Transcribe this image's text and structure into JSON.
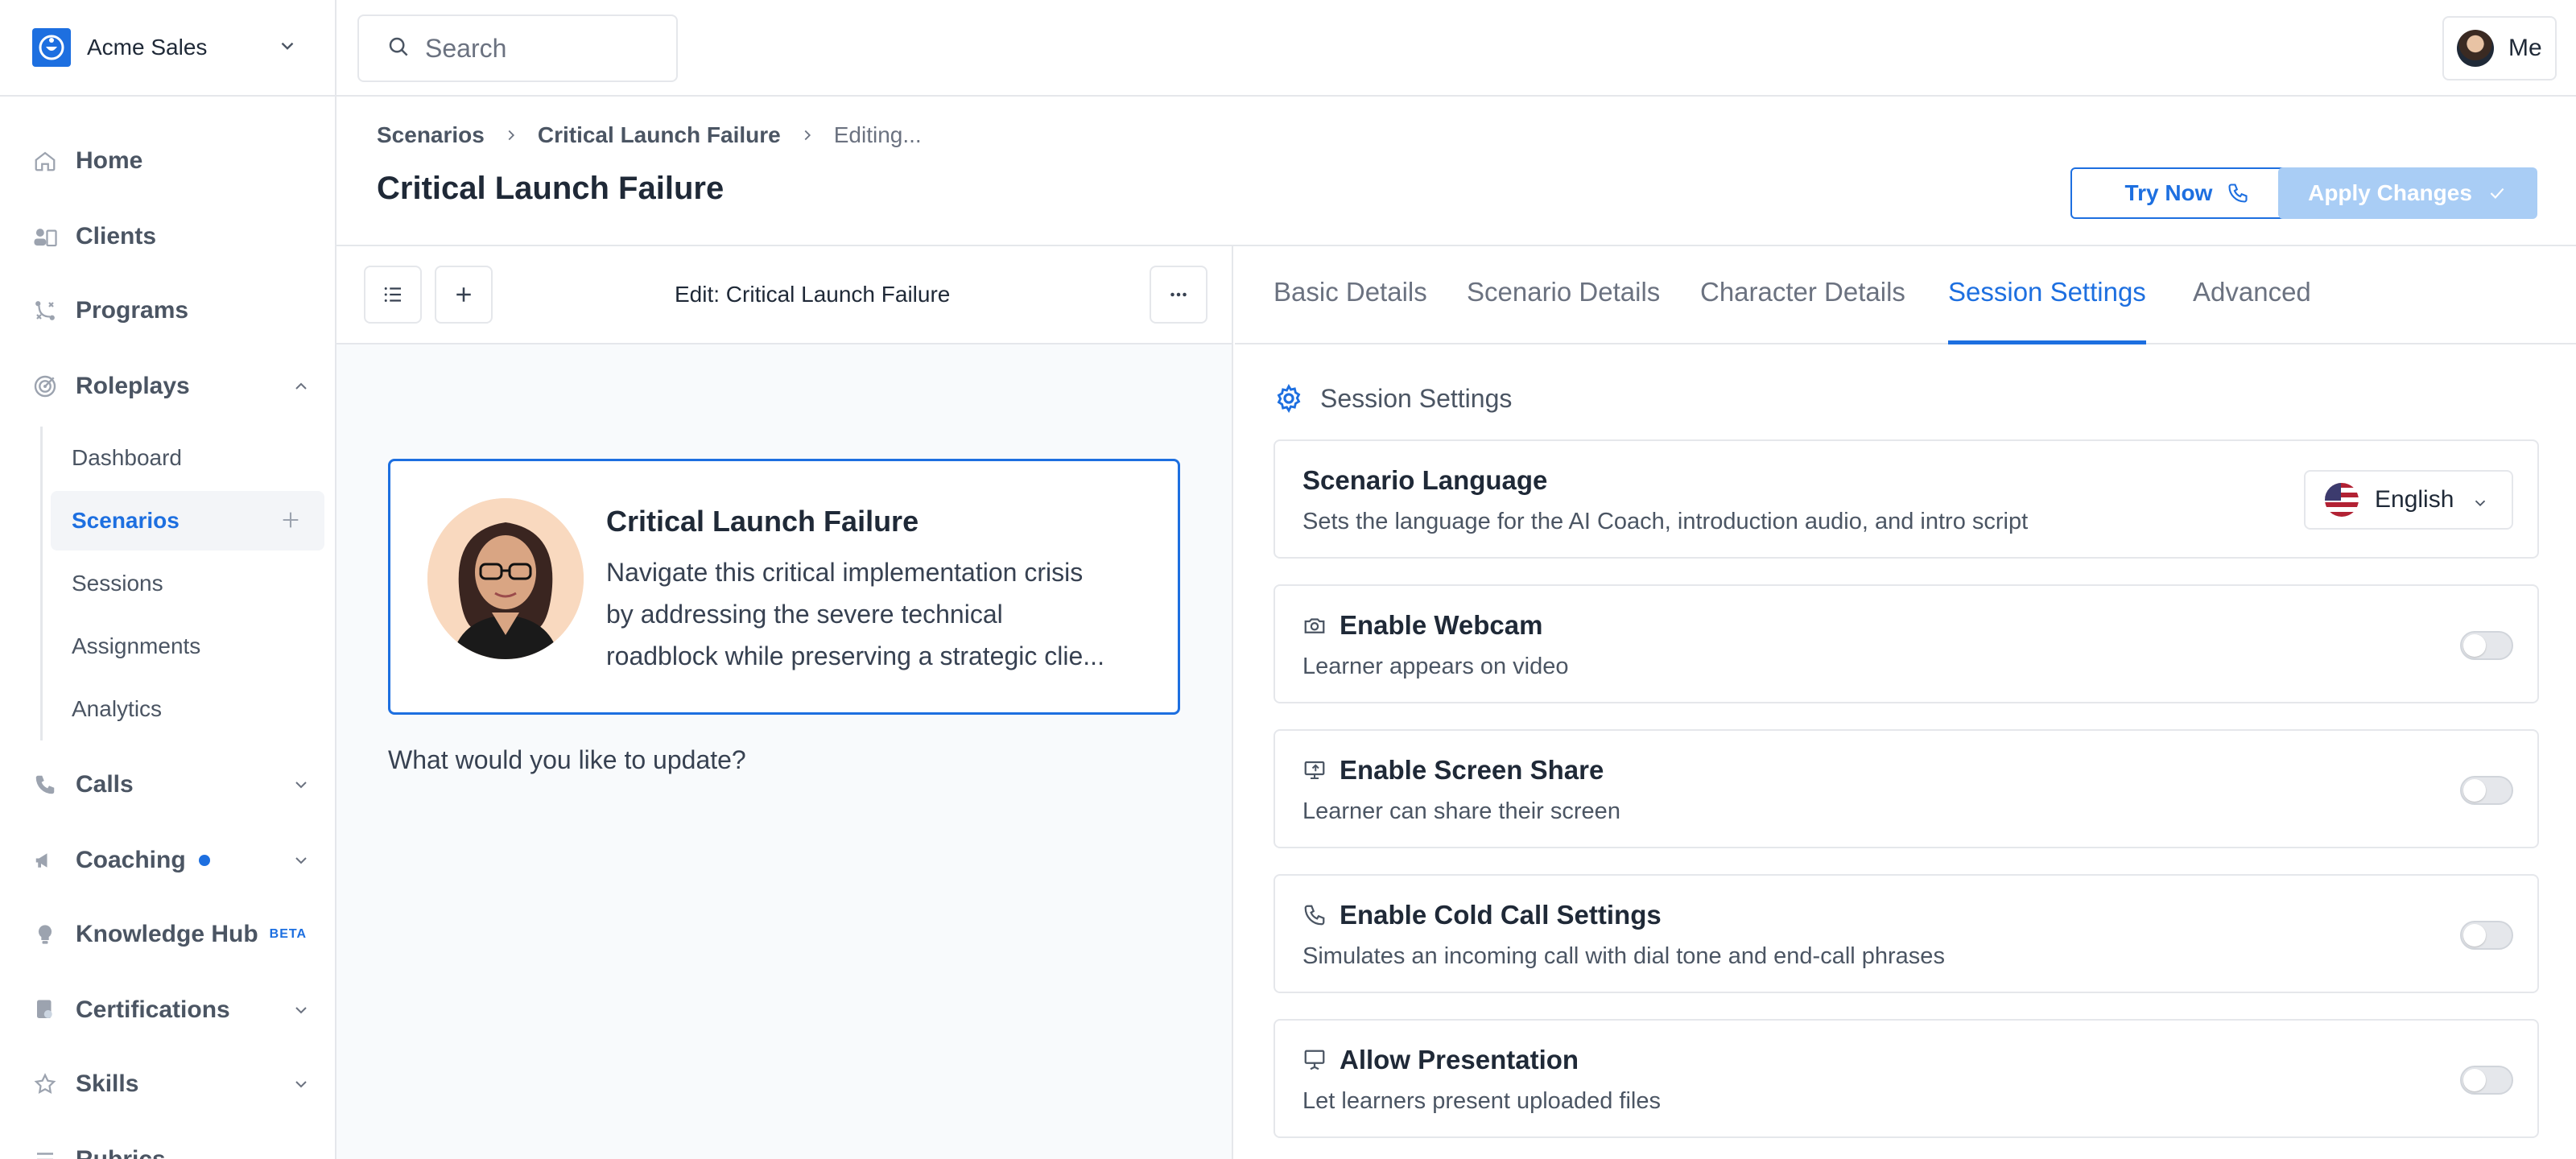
{
  "org": {
    "name": "Acme Sales"
  },
  "search": {
    "placeholder": "Search"
  },
  "user": {
    "label": "Me"
  },
  "nav": {
    "home": "Home",
    "clients": "Clients",
    "programs": "Programs",
    "roleplays": "Roleplays",
    "roleplays_sub": [
      "Dashboard",
      "Scenarios",
      "Sessions",
      "Assignments",
      "Analytics"
    ],
    "calls": "Calls",
    "coaching": "Coaching",
    "knowledge_hub": "Knowledge Hub",
    "knowledge_hub_badge": "BETA",
    "certifications": "Certifications",
    "skills": "Skills",
    "rubrics": "Rubrics"
  },
  "breadcrumb": [
    "Scenarios",
    "Critical Launch Failure",
    "Editing..."
  ],
  "page_title": "Critical Launch Failure",
  "actions": {
    "try_now": "Try Now",
    "apply_changes": "Apply Changes"
  },
  "editor": {
    "title": "Edit: Critical Launch Failure",
    "card_title": "Critical Launch Failure",
    "card_desc_lines": [
      "Navigate this critical implementation crisis",
      "by addressing the severe technical",
      "roadblock while preserving a strategic clie..."
    ],
    "question": "What would you like to update?"
  },
  "tabs": [
    "Basic Details",
    "Scenario Details",
    "Character Details",
    "Session Settings",
    "Advanced"
  ],
  "active_tab": "Session Settings",
  "settings": {
    "section_title": "Session Settings",
    "language": {
      "title": "Scenario Language",
      "desc": "Sets the language for the AI Coach, introduction audio, and intro script",
      "value": "English"
    },
    "webcam": {
      "title": "Enable Webcam",
      "desc": "Learner appears on video",
      "enabled": false
    },
    "screen_share": {
      "title": "Enable Screen Share",
      "desc": "Learner can share their screen",
      "enabled": false
    },
    "cold_call": {
      "title": "Enable Cold Call Settings",
      "desc": "Simulates an incoming call with dial tone and end-call phrases",
      "enabled": false
    },
    "presentation": {
      "title": "Allow Presentation",
      "desc": "Let learners present uploaded files",
      "enabled": false
    }
  },
  "colors": {
    "accent": "#1d6fe0",
    "apply_disabled": "#a9cdf5",
    "border": "#e5e7eb"
  }
}
